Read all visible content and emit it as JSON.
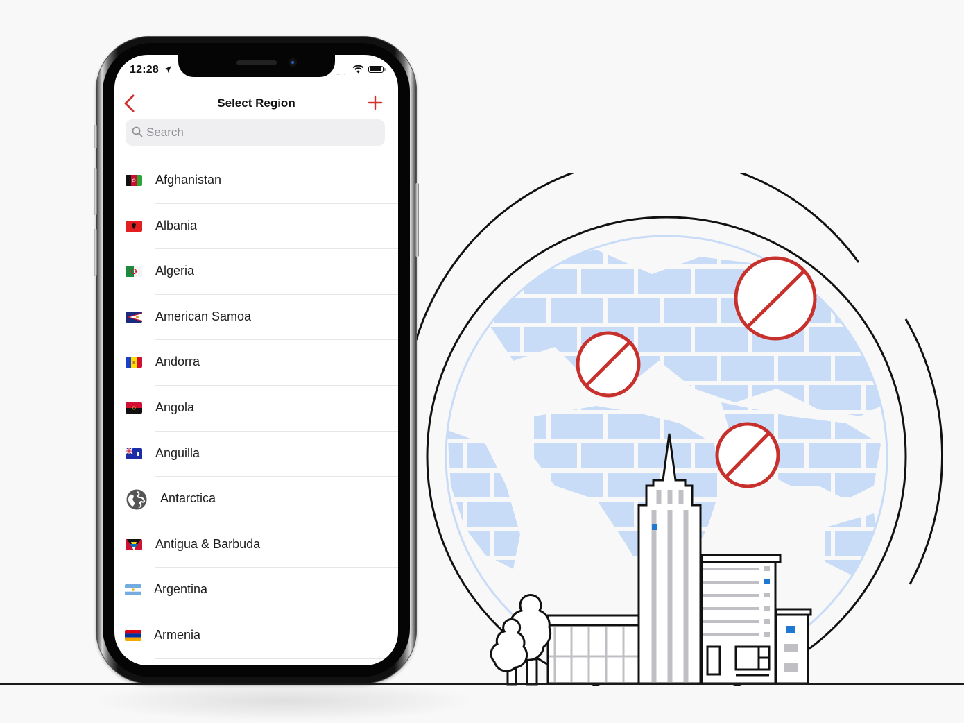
{
  "status_bar": {
    "time": "12:28",
    "location_icon": "location-arrow-icon",
    "signal_dots": ".....",
    "wifi_icon": "wifi-icon",
    "battery_icon": "battery-icon",
    "battery_level": 0.85
  },
  "nav": {
    "back_icon": "chevron-left-icon",
    "title": "Select Region",
    "add_icon": "plus-icon"
  },
  "search": {
    "placeholder": "Search",
    "value": "",
    "icon": "search-icon"
  },
  "regions": [
    {
      "name": "Afghanistan",
      "flag": "afghanistan-flag"
    },
    {
      "name": "Albania",
      "flag": "albania-flag"
    },
    {
      "name": "Algeria",
      "flag": "algeria-flag"
    },
    {
      "name": "American Samoa",
      "flag": "american-samoa-flag"
    },
    {
      "name": "Andorra",
      "flag": "andorra-flag"
    },
    {
      "name": "Angola",
      "flag": "angola-flag"
    },
    {
      "name": "Anguilla",
      "flag": "anguilla-flag"
    },
    {
      "name": "Antarctica",
      "flag": "globe-icon"
    },
    {
      "name": "Antigua & Barbuda",
      "flag": "antigua-barbuda-flag"
    },
    {
      "name": "Argentina",
      "flag": "argentina-flag"
    },
    {
      "name": "Armenia",
      "flag": "armenia-flag"
    }
  ],
  "colors": {
    "accent": "#d0312d",
    "globe_fill": "#c9dcf7",
    "blocked_sign": "#c8302c",
    "window_blue": "#1f78d1",
    "window_gray": "#c0c0c4",
    "background": "#f8f8f8"
  },
  "illustration": {
    "description": "Globe with brick wall and blocked signs behind city buildings",
    "blocked_sign_icon": "prohibited-icon",
    "blocked_sign_count": 3
  }
}
